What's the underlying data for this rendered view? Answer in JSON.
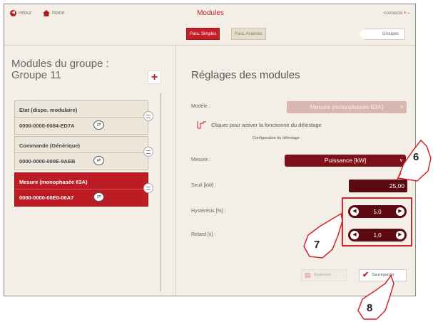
{
  "header": {
    "back_label": "retour",
    "home_label": "home",
    "title": "Modules",
    "connected_label": "connecté"
  },
  "tabs": {
    "simple": "Para. Simples",
    "advanced": "Para. Avancés",
    "groups": "Groupes"
  },
  "group": {
    "title_line1": "Modules du groupe :",
    "title_line2": "Groupe 11",
    "add_icon": "plus-icon",
    "modules": [
      {
        "name": "Etat (dispo. modulaire)",
        "id": "0000-0000-0084-ED7A",
        "active": false
      },
      {
        "name": "Commande (Générique)",
        "id": "0000-0000-000E-9AEB",
        "active": false
      },
      {
        "name": "Mesure (monophasée 63A)",
        "id": "0000-0000-00E0-06A7",
        "active": true
      }
    ]
  },
  "settings": {
    "title": "Réglages des modules",
    "model_label": "Modèle :",
    "model_value": "Mesure (monophasée 63A)",
    "delestage_text": "Cliquer pour activer la fonctionne du délestage",
    "config_label": "Configuration du délestage :",
    "measure_label": "Mesure :",
    "measure_value": "Puissance [kW]",
    "threshold_label": "Seuil [kW] :",
    "threshold_value": "25,00",
    "hysteresis_label": "Hystérésis [%] :",
    "hysteresis_value": "5,0",
    "delay_label": "Retard [s] :",
    "delay_value": "1,0",
    "delete_label": "Supprimer",
    "save_label": "Sauvegarder"
  },
  "callouts": [
    "6",
    "7",
    "8"
  ],
  "colors": {
    "accent": "#c21f28",
    "dark_red": "#5a0a10",
    "background": "#f4efe6",
    "callout": "#d7222b"
  }
}
